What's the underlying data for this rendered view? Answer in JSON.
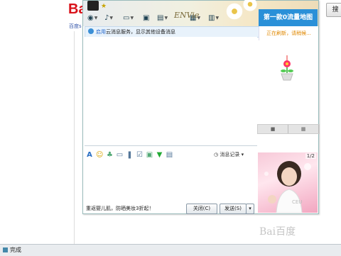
{
  "browser": {
    "brand_text": "Ba",
    "brand_sub": "百度s",
    "search_button": "搜"
  },
  "chat": {
    "deco_text": "ENVie",
    "banner": "第一款0流量地图",
    "refresh": "正在刷新，请稍候...",
    "notice": {
      "link": "启用",
      "text": "云消息服务，显示其他设备消息"
    },
    "side_tab_icons": [
      "square-icon",
      "grid-icon"
    ],
    "message_record": "消息记录",
    "ad_text": "重返婴儿肌，防晒美妆3折起！",
    "close_button": "关闭(C)",
    "send_button": "发送(S)",
    "send_dropdown": "▾",
    "page_indicator": "1/2",
    "photo_caption": "CEU"
  },
  "status_bar": {
    "text": "完成"
  },
  "watermark": "Bai百度"
}
